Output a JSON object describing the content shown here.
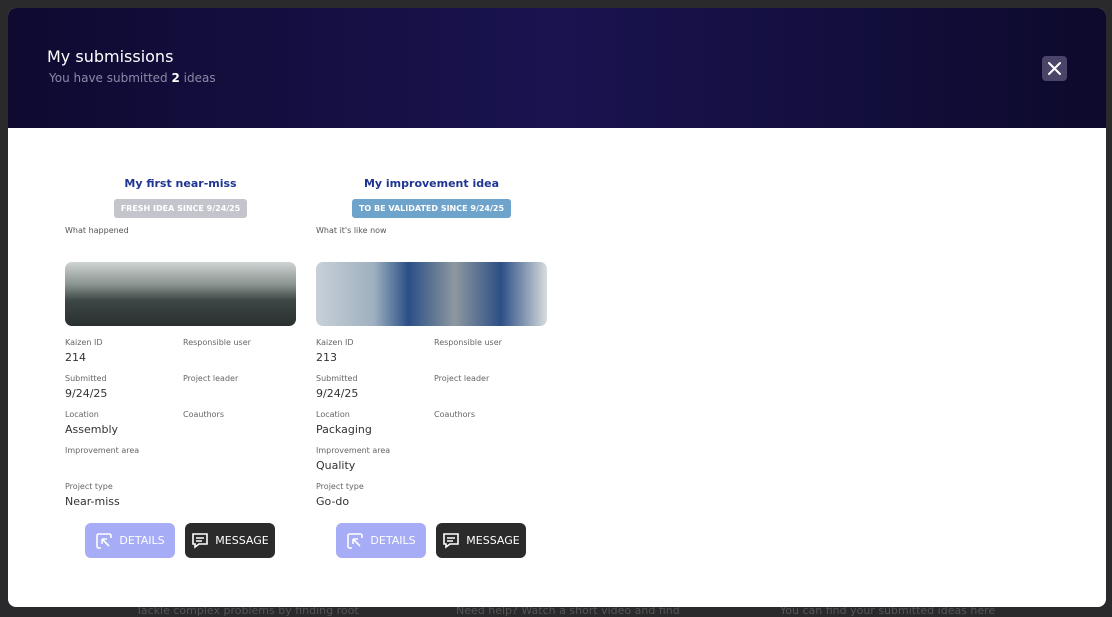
{
  "background": {
    "texts": [
      "Tackle complex problems by finding root",
      "Need help? Watch a short video and find",
      "You can find your submitted ideas here"
    ]
  },
  "modal": {
    "title": "My submissions",
    "subtitle_prefix": "You have submitted ",
    "count": "2",
    "subtitle_suffix": " ideas",
    "close_icon": "close-icon"
  },
  "cards": [
    {
      "title": "My first near-miss",
      "badge": "FRESH IDEA SINCE 9/24/25",
      "badge_color": "#c3c4cc",
      "description_label": "What happened",
      "fields": [
        {
          "label": "Kaizen ID",
          "value": "214"
        },
        {
          "label": "Responsible user",
          "value": ""
        },
        {
          "label": "Submitted",
          "value": "9/24/25"
        },
        {
          "label": "Project leader",
          "value": ""
        },
        {
          "label": "Location",
          "value": "Assembly"
        },
        {
          "label": "Coauthors",
          "value": ""
        },
        {
          "label": "Improvement area",
          "value": ""
        },
        {
          "label": "",
          "value": ""
        },
        {
          "label": "Project type",
          "value": "Near-miss"
        }
      ],
      "details_label": "DETAILS",
      "message_label": "MESSAGE"
    },
    {
      "title": "My improvement idea",
      "badge": "TO BE VALIDATED SINCE 9/24/25",
      "badge_color": "#6ea3cb",
      "description_label": "What it's like now",
      "fields": [
        {
          "label": "Kaizen ID",
          "value": "213"
        },
        {
          "label": "Responsible user",
          "value": ""
        },
        {
          "label": "Submitted",
          "value": "9/24/25"
        },
        {
          "label": "Project leader",
          "value": ""
        },
        {
          "label": "Location",
          "value": "Packaging"
        },
        {
          "label": "Coauthors",
          "value": ""
        },
        {
          "label": "Improvement area",
          "value": "Quality"
        },
        {
          "label": "",
          "value": ""
        },
        {
          "label": "Project type",
          "value": "Go-do"
        }
      ],
      "details_label": "DETAILS",
      "message_label": "MESSAGE"
    }
  ]
}
